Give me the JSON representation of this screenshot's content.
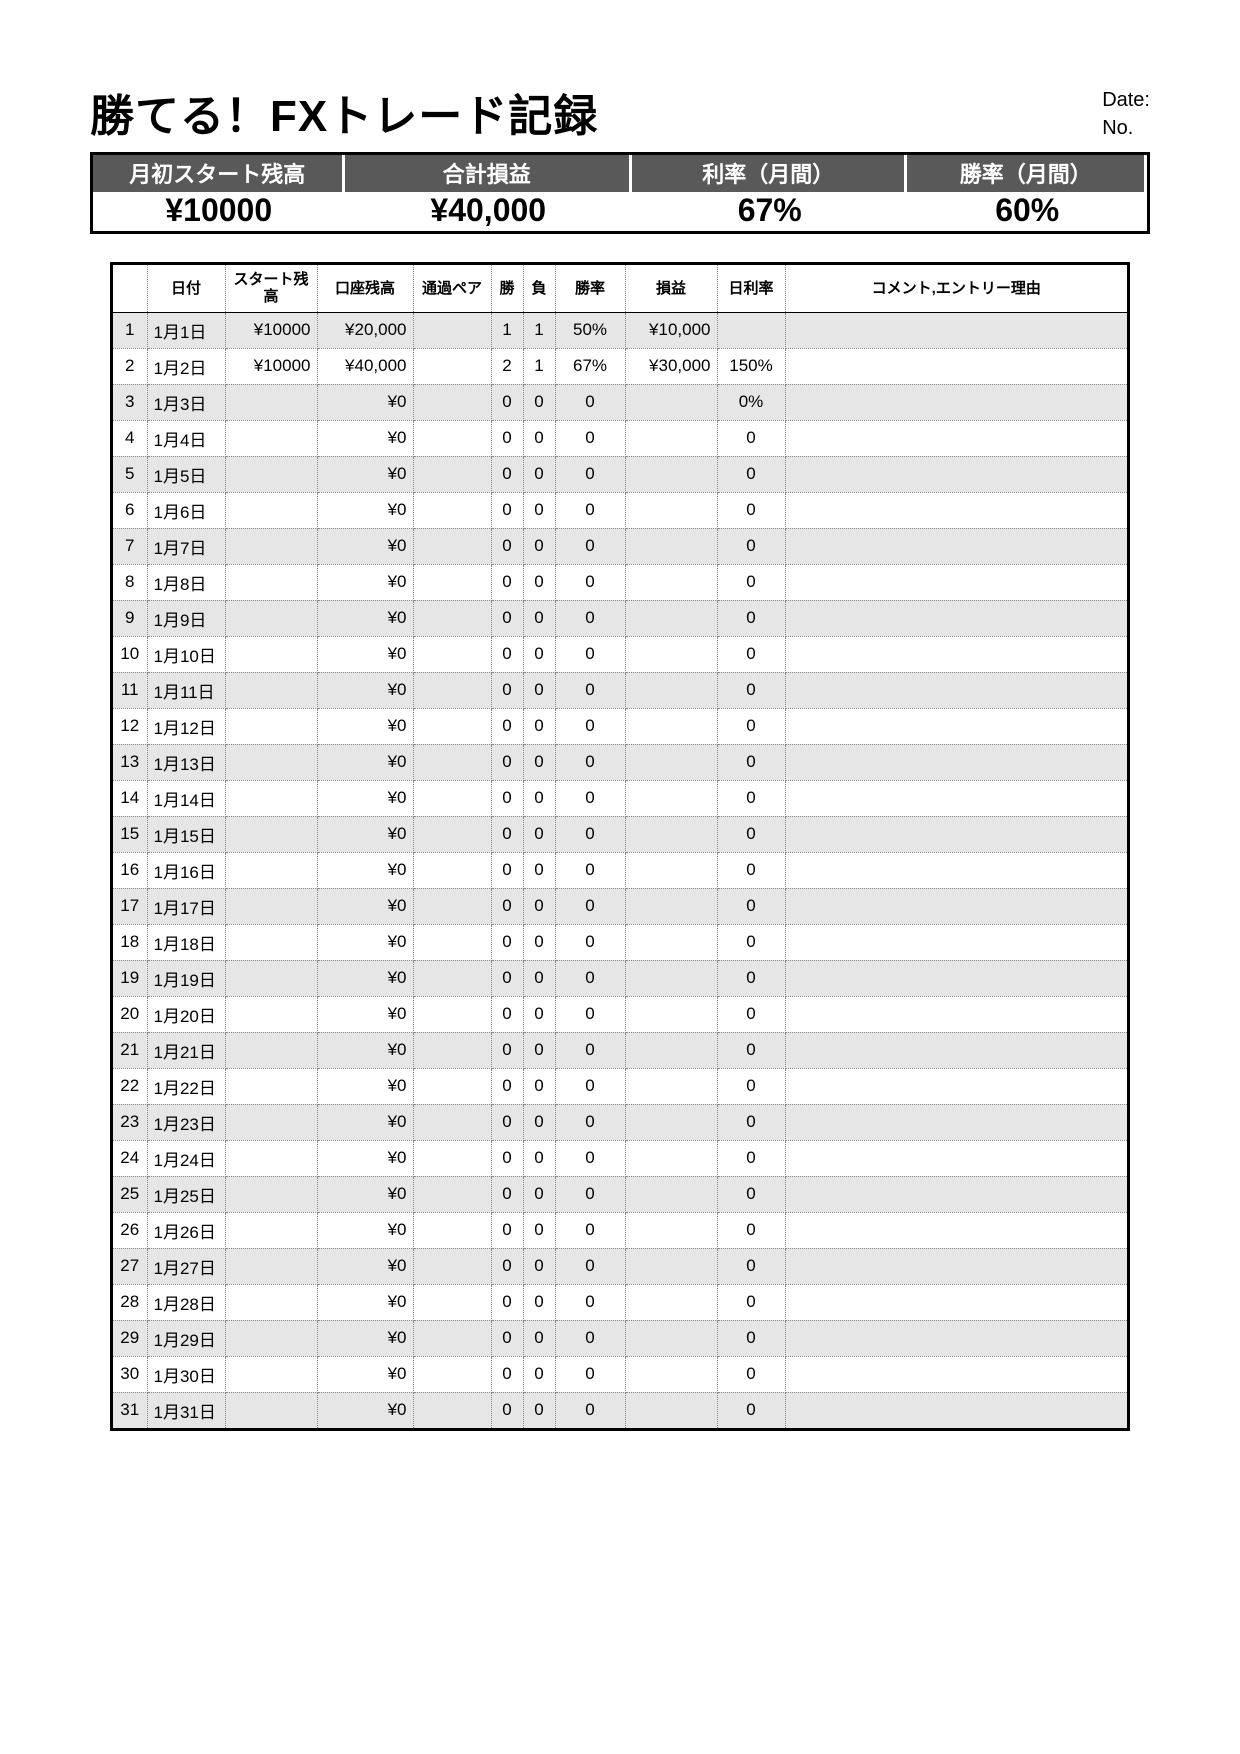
{
  "title": "勝てる！FXトレード記録",
  "meta": {
    "date_label": "Date:",
    "no_label": "No."
  },
  "summary": {
    "headers": [
      "月初スタート残高",
      "合計損益",
      "利率（月間）",
      "勝率（月間）"
    ],
    "values": [
      "¥10000",
      "¥40,000",
      "67%",
      "60%"
    ]
  },
  "table": {
    "headers": [
      "",
      "日付",
      "スタート残高",
      "口座残高",
      "通過ペア",
      "勝",
      "負",
      "勝率",
      "損益",
      "日利率",
      "コメント,エントリー理由"
    ],
    "rows": [
      {
        "idx": "1",
        "date": "1月1日",
        "start": "¥10000",
        "bal": "¥20,000",
        "pair": "",
        "win": "1",
        "lose": "1",
        "rate": "50%",
        "pl": "¥10,000",
        "dayrate": "",
        "comment": ""
      },
      {
        "idx": "2",
        "date": "1月2日",
        "start": "¥10000",
        "bal": "¥40,000",
        "pair": "",
        "win": "2",
        "lose": "1",
        "rate": "67%",
        "pl": "¥30,000",
        "dayrate": "150%",
        "comment": ""
      },
      {
        "idx": "3",
        "date": "1月3日",
        "start": "",
        "bal": "¥0",
        "pair": "",
        "win": "0",
        "lose": "0",
        "rate": "0",
        "pl": "",
        "dayrate": "0%",
        "comment": ""
      },
      {
        "idx": "4",
        "date": "1月4日",
        "start": "",
        "bal": "¥0",
        "pair": "",
        "win": "0",
        "lose": "0",
        "rate": "0",
        "pl": "",
        "dayrate": "0",
        "comment": ""
      },
      {
        "idx": "5",
        "date": "1月5日",
        "start": "",
        "bal": "¥0",
        "pair": "",
        "win": "0",
        "lose": "0",
        "rate": "0",
        "pl": "",
        "dayrate": "0",
        "comment": ""
      },
      {
        "idx": "6",
        "date": "1月6日",
        "start": "",
        "bal": "¥0",
        "pair": "",
        "win": "0",
        "lose": "0",
        "rate": "0",
        "pl": "",
        "dayrate": "0",
        "comment": ""
      },
      {
        "idx": "7",
        "date": "1月7日",
        "start": "",
        "bal": "¥0",
        "pair": "",
        "win": "0",
        "lose": "0",
        "rate": "0",
        "pl": "",
        "dayrate": "0",
        "comment": ""
      },
      {
        "idx": "8",
        "date": "1月8日",
        "start": "",
        "bal": "¥0",
        "pair": "",
        "win": "0",
        "lose": "0",
        "rate": "0",
        "pl": "",
        "dayrate": "0",
        "comment": ""
      },
      {
        "idx": "9",
        "date": "1月9日",
        "start": "",
        "bal": "¥0",
        "pair": "",
        "win": "0",
        "lose": "0",
        "rate": "0",
        "pl": "",
        "dayrate": "0",
        "comment": ""
      },
      {
        "idx": "10",
        "date": "1月10日",
        "start": "",
        "bal": "¥0",
        "pair": "",
        "win": "0",
        "lose": "0",
        "rate": "0",
        "pl": "",
        "dayrate": "0",
        "comment": ""
      },
      {
        "idx": "11",
        "date": "1月11日",
        "start": "",
        "bal": "¥0",
        "pair": "",
        "win": "0",
        "lose": "0",
        "rate": "0",
        "pl": "",
        "dayrate": "0",
        "comment": ""
      },
      {
        "idx": "12",
        "date": "1月12日",
        "start": "",
        "bal": "¥0",
        "pair": "",
        "win": "0",
        "lose": "0",
        "rate": "0",
        "pl": "",
        "dayrate": "0",
        "comment": ""
      },
      {
        "idx": "13",
        "date": "1月13日",
        "start": "",
        "bal": "¥0",
        "pair": "",
        "win": "0",
        "lose": "0",
        "rate": "0",
        "pl": "",
        "dayrate": "0",
        "comment": ""
      },
      {
        "idx": "14",
        "date": "1月14日",
        "start": "",
        "bal": "¥0",
        "pair": "",
        "win": "0",
        "lose": "0",
        "rate": "0",
        "pl": "",
        "dayrate": "0",
        "comment": ""
      },
      {
        "idx": "15",
        "date": "1月15日",
        "start": "",
        "bal": "¥0",
        "pair": "",
        "win": "0",
        "lose": "0",
        "rate": "0",
        "pl": "",
        "dayrate": "0",
        "comment": ""
      },
      {
        "idx": "16",
        "date": "1月16日",
        "start": "",
        "bal": "¥0",
        "pair": "",
        "win": "0",
        "lose": "0",
        "rate": "0",
        "pl": "",
        "dayrate": "0",
        "comment": ""
      },
      {
        "idx": "17",
        "date": "1月17日",
        "start": "",
        "bal": "¥0",
        "pair": "",
        "win": "0",
        "lose": "0",
        "rate": "0",
        "pl": "",
        "dayrate": "0",
        "comment": ""
      },
      {
        "idx": "18",
        "date": "1月18日",
        "start": "",
        "bal": "¥0",
        "pair": "",
        "win": "0",
        "lose": "0",
        "rate": "0",
        "pl": "",
        "dayrate": "0",
        "comment": ""
      },
      {
        "idx": "19",
        "date": "1月19日",
        "start": "",
        "bal": "¥0",
        "pair": "",
        "win": "0",
        "lose": "0",
        "rate": "0",
        "pl": "",
        "dayrate": "0",
        "comment": ""
      },
      {
        "idx": "20",
        "date": "1月20日",
        "start": "",
        "bal": "¥0",
        "pair": "",
        "win": "0",
        "lose": "0",
        "rate": "0",
        "pl": "",
        "dayrate": "0",
        "comment": ""
      },
      {
        "idx": "21",
        "date": "1月21日",
        "start": "",
        "bal": "¥0",
        "pair": "",
        "win": "0",
        "lose": "0",
        "rate": "0",
        "pl": "",
        "dayrate": "0",
        "comment": ""
      },
      {
        "idx": "22",
        "date": "1月22日",
        "start": "",
        "bal": "¥0",
        "pair": "",
        "win": "0",
        "lose": "0",
        "rate": "0",
        "pl": "",
        "dayrate": "0",
        "comment": ""
      },
      {
        "idx": "23",
        "date": "1月23日",
        "start": "",
        "bal": "¥0",
        "pair": "",
        "win": "0",
        "lose": "0",
        "rate": "0",
        "pl": "",
        "dayrate": "0",
        "comment": ""
      },
      {
        "idx": "24",
        "date": "1月24日",
        "start": "",
        "bal": "¥0",
        "pair": "",
        "win": "0",
        "lose": "0",
        "rate": "0",
        "pl": "",
        "dayrate": "0",
        "comment": ""
      },
      {
        "idx": "25",
        "date": "1月25日",
        "start": "",
        "bal": "¥0",
        "pair": "",
        "win": "0",
        "lose": "0",
        "rate": "0",
        "pl": "",
        "dayrate": "0",
        "comment": ""
      },
      {
        "idx": "26",
        "date": "1月26日",
        "start": "",
        "bal": "¥0",
        "pair": "",
        "win": "0",
        "lose": "0",
        "rate": "0",
        "pl": "",
        "dayrate": "0",
        "comment": ""
      },
      {
        "idx": "27",
        "date": "1月27日",
        "start": "",
        "bal": "¥0",
        "pair": "",
        "win": "0",
        "lose": "0",
        "rate": "0",
        "pl": "",
        "dayrate": "0",
        "comment": ""
      },
      {
        "idx": "28",
        "date": "1月28日",
        "start": "",
        "bal": "¥0",
        "pair": "",
        "win": "0",
        "lose": "0",
        "rate": "0",
        "pl": "",
        "dayrate": "0",
        "comment": ""
      },
      {
        "idx": "29",
        "date": "1月29日",
        "start": "",
        "bal": "¥0",
        "pair": "",
        "win": "0",
        "lose": "0",
        "rate": "0",
        "pl": "",
        "dayrate": "0",
        "comment": ""
      },
      {
        "idx": "30",
        "date": "1月30日",
        "start": "",
        "bal": "¥0",
        "pair": "",
        "win": "0",
        "lose": "0",
        "rate": "0",
        "pl": "",
        "dayrate": "0",
        "comment": ""
      },
      {
        "idx": "31",
        "date": "1月31日",
        "start": "",
        "bal": "¥0",
        "pair": "",
        "win": "0",
        "lose": "0",
        "rate": "0",
        "pl": "",
        "dayrate": "0",
        "comment": ""
      }
    ]
  }
}
